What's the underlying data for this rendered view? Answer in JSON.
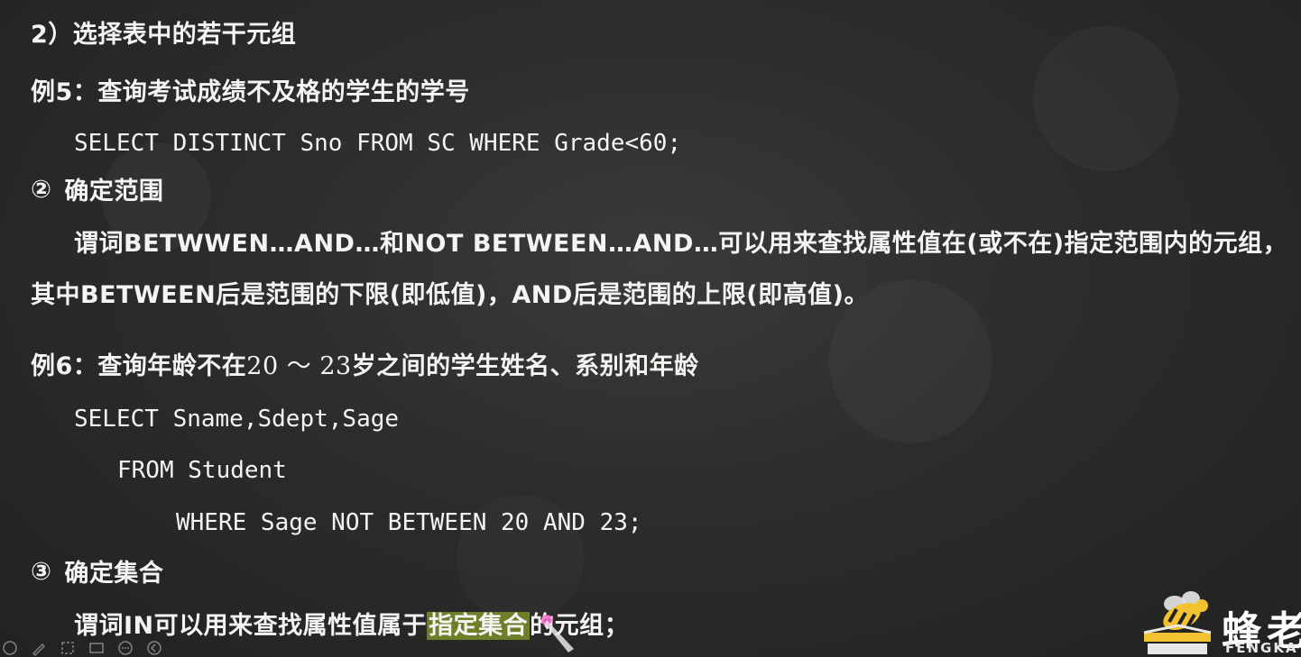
{
  "slide": {
    "heading": "2）选择表中的若干元组",
    "ex5": {
      "label": "例5：查询考试成绩不及格的学生的学号",
      "sql": "SELECT DISTINCT Sno FROM SC WHERE Grade<60;"
    },
    "sec2": {
      "num": "②",
      "title": "确定范围",
      "desc1": "谓词BETWWEN…AND…和NOT BETWEEN…AND…可以用来查找属性值在(或不在)指定范围内的元组，",
      "desc2": "其中BETWEEN后是范围的下限(即低值)，AND后是范围的上限(即高值)。"
    },
    "ex6": {
      "label_pre": "例6：查询年龄不在",
      "range": "20 ～ 23",
      "label_post": "岁之间的学生姓名、系别和年龄",
      "sql1": "SELECT Sname,Sdept,Sage",
      "sql2": "FROM Student",
      "sql3": "WHERE Sage NOT BETWEEN 20 AND 23;"
    },
    "sec3": {
      "num": "③",
      "title": "确定集合",
      "desc_pre": "谓词IN可以用来查找属性值属于",
      "desc_highlight": "指定集合",
      "desc_post": "的元组；"
    }
  },
  "logo": {
    "cn": "蜂老",
    "en": "FENGKA"
  },
  "colors": {
    "board": "#2c2c2a",
    "chalk": "#f4f4f2",
    "highlight": "#6e7f2a",
    "logo_yellow": "#f2c230"
  },
  "toolbar": {
    "icons": [
      "prev-icon",
      "pen-icon",
      "zoom-icon",
      "screen-icon",
      "more-icon",
      "back-icon"
    ]
  }
}
